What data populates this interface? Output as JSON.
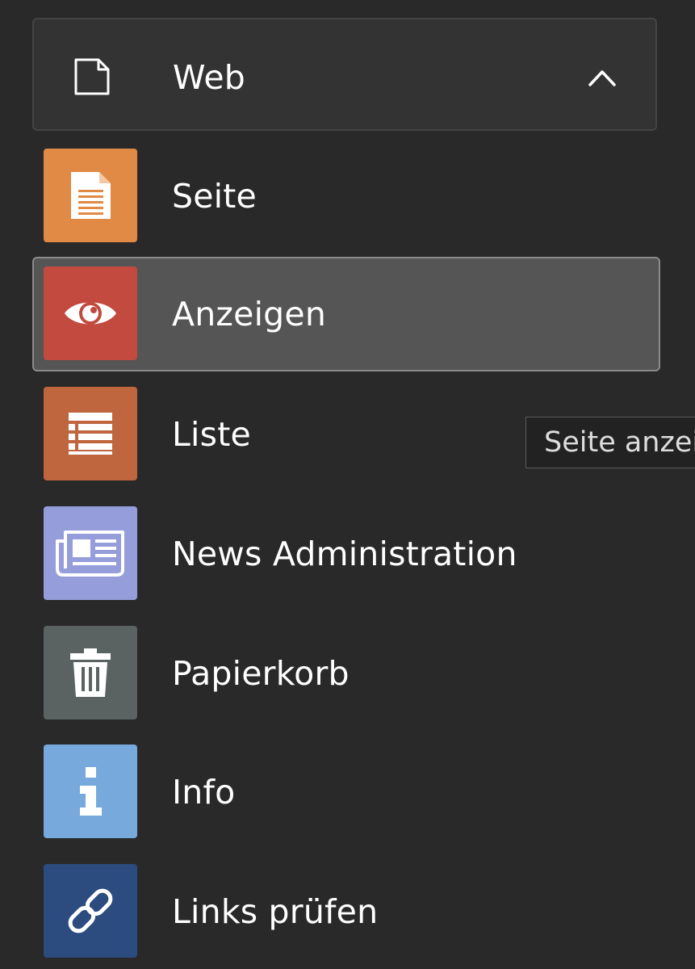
{
  "group": {
    "label": "Web",
    "icon": "page-icon",
    "expanded": true
  },
  "items": [
    {
      "label": "Seite",
      "icon": "document-icon",
      "color": "#E08A45",
      "active": false
    },
    {
      "label": "Anzeigen",
      "icon": "eye-icon",
      "color": "#C24A3E",
      "active": true
    },
    {
      "label": "Liste",
      "icon": "list-icon",
      "color": "#C0663F",
      "active": false
    },
    {
      "label": "News Administration",
      "icon": "newspaper-icon",
      "color": "#959DDB",
      "active": false
    },
    {
      "label": "Papierkorb",
      "icon": "trash-icon",
      "color": "#5A6262",
      "active": false
    },
    {
      "label": "Info",
      "icon": "info-icon",
      "color": "#77A9DD",
      "active": false
    },
    {
      "label": "Links prüfen",
      "icon": "link-icon",
      "color": "#2C4B7E",
      "active": false
    }
  ],
  "tooltip": {
    "text": "Seite anzeigen"
  }
}
